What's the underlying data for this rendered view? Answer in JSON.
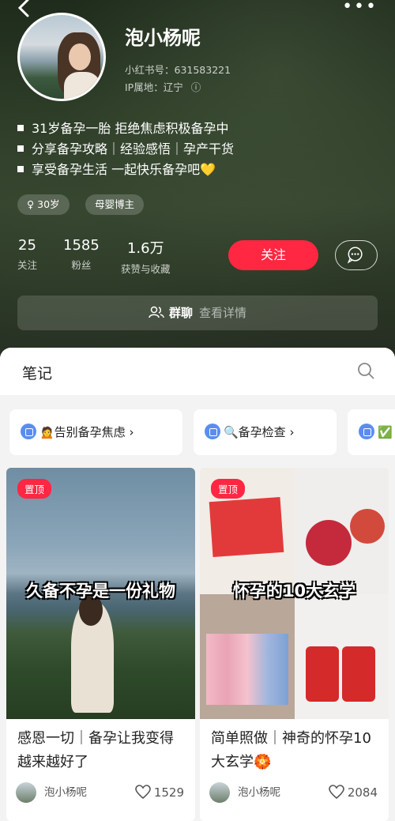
{
  "header": {
    "back_icon": "chevron-left-icon",
    "more_icon": "more-dots-icon",
    "more_label": "•••"
  },
  "profile": {
    "name": "泡小杨呢",
    "red_id": "小红书号：631583221",
    "ip": "IP属地：辽宁",
    "ip_info_icon": "ⓘ",
    "bio": [
      "31岁备孕一胎 拒绝焦虑积极备孕中",
      "分享备孕攻略｜经验感悟｜孕产干货",
      "享受备孕生活 一起快乐备孕吧💛"
    ],
    "tags": [
      {
        "label": "♀ 30岁"
      },
      {
        "label": "母婴博主"
      }
    ],
    "stats": [
      {
        "value": "25",
        "label": "关注"
      },
      {
        "value": "1585",
        "label": "粉丝"
      },
      {
        "value": "1.6万",
        "label": "获赞与收藏"
      }
    ],
    "follow_label": "关注",
    "group_label": "群聊",
    "group_detail": "查看详情"
  },
  "notes": {
    "title": "笔记",
    "collections": [
      {
        "label": "🙍告别备孕焦虑 ›"
      },
      {
        "label": "🔍备孕检查 ›"
      },
      {
        "label": "✅"
      }
    ],
    "cards": [
      {
        "pinned": "置顶",
        "overlay": "久备不孕是一份礼物",
        "title": "感恩一切｜备孕让我变得越来越好了",
        "author": "泡小杨呢",
        "likes": "1529"
      },
      {
        "pinned": "置顶",
        "overlay": "怀孕的10大玄学",
        "title": "简单照做｜神奇的怀孕10大玄学🏵️",
        "author": "泡小杨呢",
        "likes": "2084"
      }
    ]
  },
  "colors": {
    "accent": "#ff2742"
  }
}
